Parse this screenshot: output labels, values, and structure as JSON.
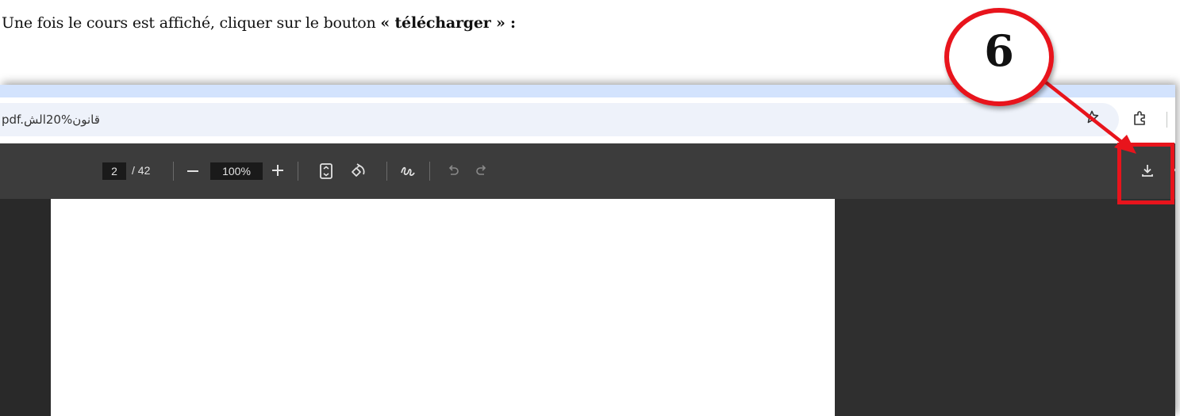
{
  "instruction": {
    "prefix": "Une fois le cours est affiché, cliquer sur le bouton ",
    "open_quote": "« ",
    "keyword": "télécharger",
    "close_quote": " » :"
  },
  "browser": {
    "url": "pdf.قانون%20الش"
  },
  "pdf_toolbar": {
    "page_current": "2",
    "page_total": "/ 42",
    "zoom": "100%"
  },
  "callout": {
    "number": "6",
    "color": "#e8141c"
  },
  "icons": {
    "bookmark": "star-icon",
    "extensions": "puzzle-icon",
    "fit_page": "fit-page-icon",
    "rotate": "rotate-icon",
    "annotate": "draw-icon",
    "undo": "undo-icon",
    "redo": "redo-icon",
    "download": "download-icon",
    "more": "more-icon"
  }
}
